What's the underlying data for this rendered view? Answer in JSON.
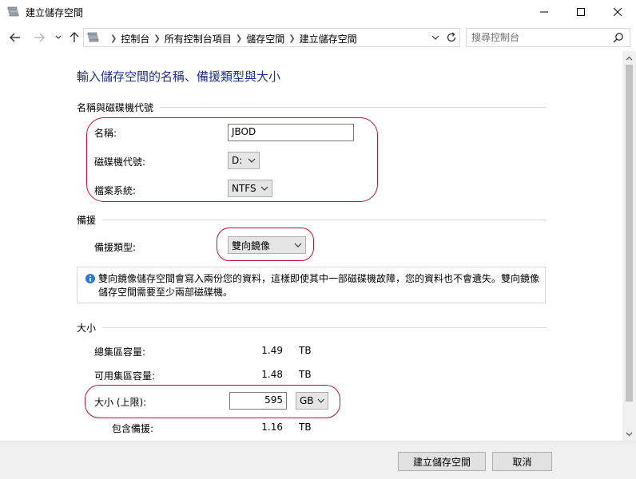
{
  "window": {
    "title": "建立儲存空間"
  },
  "address_bar": {
    "breadcrumbs": [
      "控制台",
      "所有控制台項目",
      "儲存空間",
      "建立儲存空間"
    ],
    "search_placeholder": "搜尋控制台"
  },
  "page": {
    "title": "輸入儲存空間的名稱、備援類型與大小"
  },
  "name_section": {
    "header": "名稱與磁碟機代號",
    "name_label": "名稱:",
    "name_value": "JBOD",
    "drive_label": "磁碟機代號:",
    "drive_value": "D:",
    "fs_label": "檔案系統:",
    "fs_value": "NTFS"
  },
  "resiliency_section": {
    "header": "備援",
    "type_label": "備援類型:",
    "type_value": "雙向鏡像",
    "info_text": "雙向鏡像儲存空間會寫入兩份您的資料，這樣即使其中一部磁碟機故障，您的資料也不會遺失。雙向鏡像儲存空間需要至少兩部磁碟機。"
  },
  "size_section": {
    "header": "大小",
    "total_label": "總集區容量:",
    "total_value": "1.49",
    "total_unit": "TB",
    "available_label": "可用集區容量:",
    "available_value": "1.48",
    "available_unit": "TB",
    "max_label": "大小 (上限):",
    "max_value": "595",
    "max_unit": "GB",
    "resiliency_label": "包含備援:",
    "resiliency_value": "1.16",
    "resiliency_unit": "TB"
  },
  "footer": {
    "create_label": "建立儲存空間",
    "cancel_label": "取消"
  },
  "colors": {
    "title_blue": "#1e3287",
    "highlight_red": "#c8102e",
    "info_blue": "#2b79d6"
  }
}
